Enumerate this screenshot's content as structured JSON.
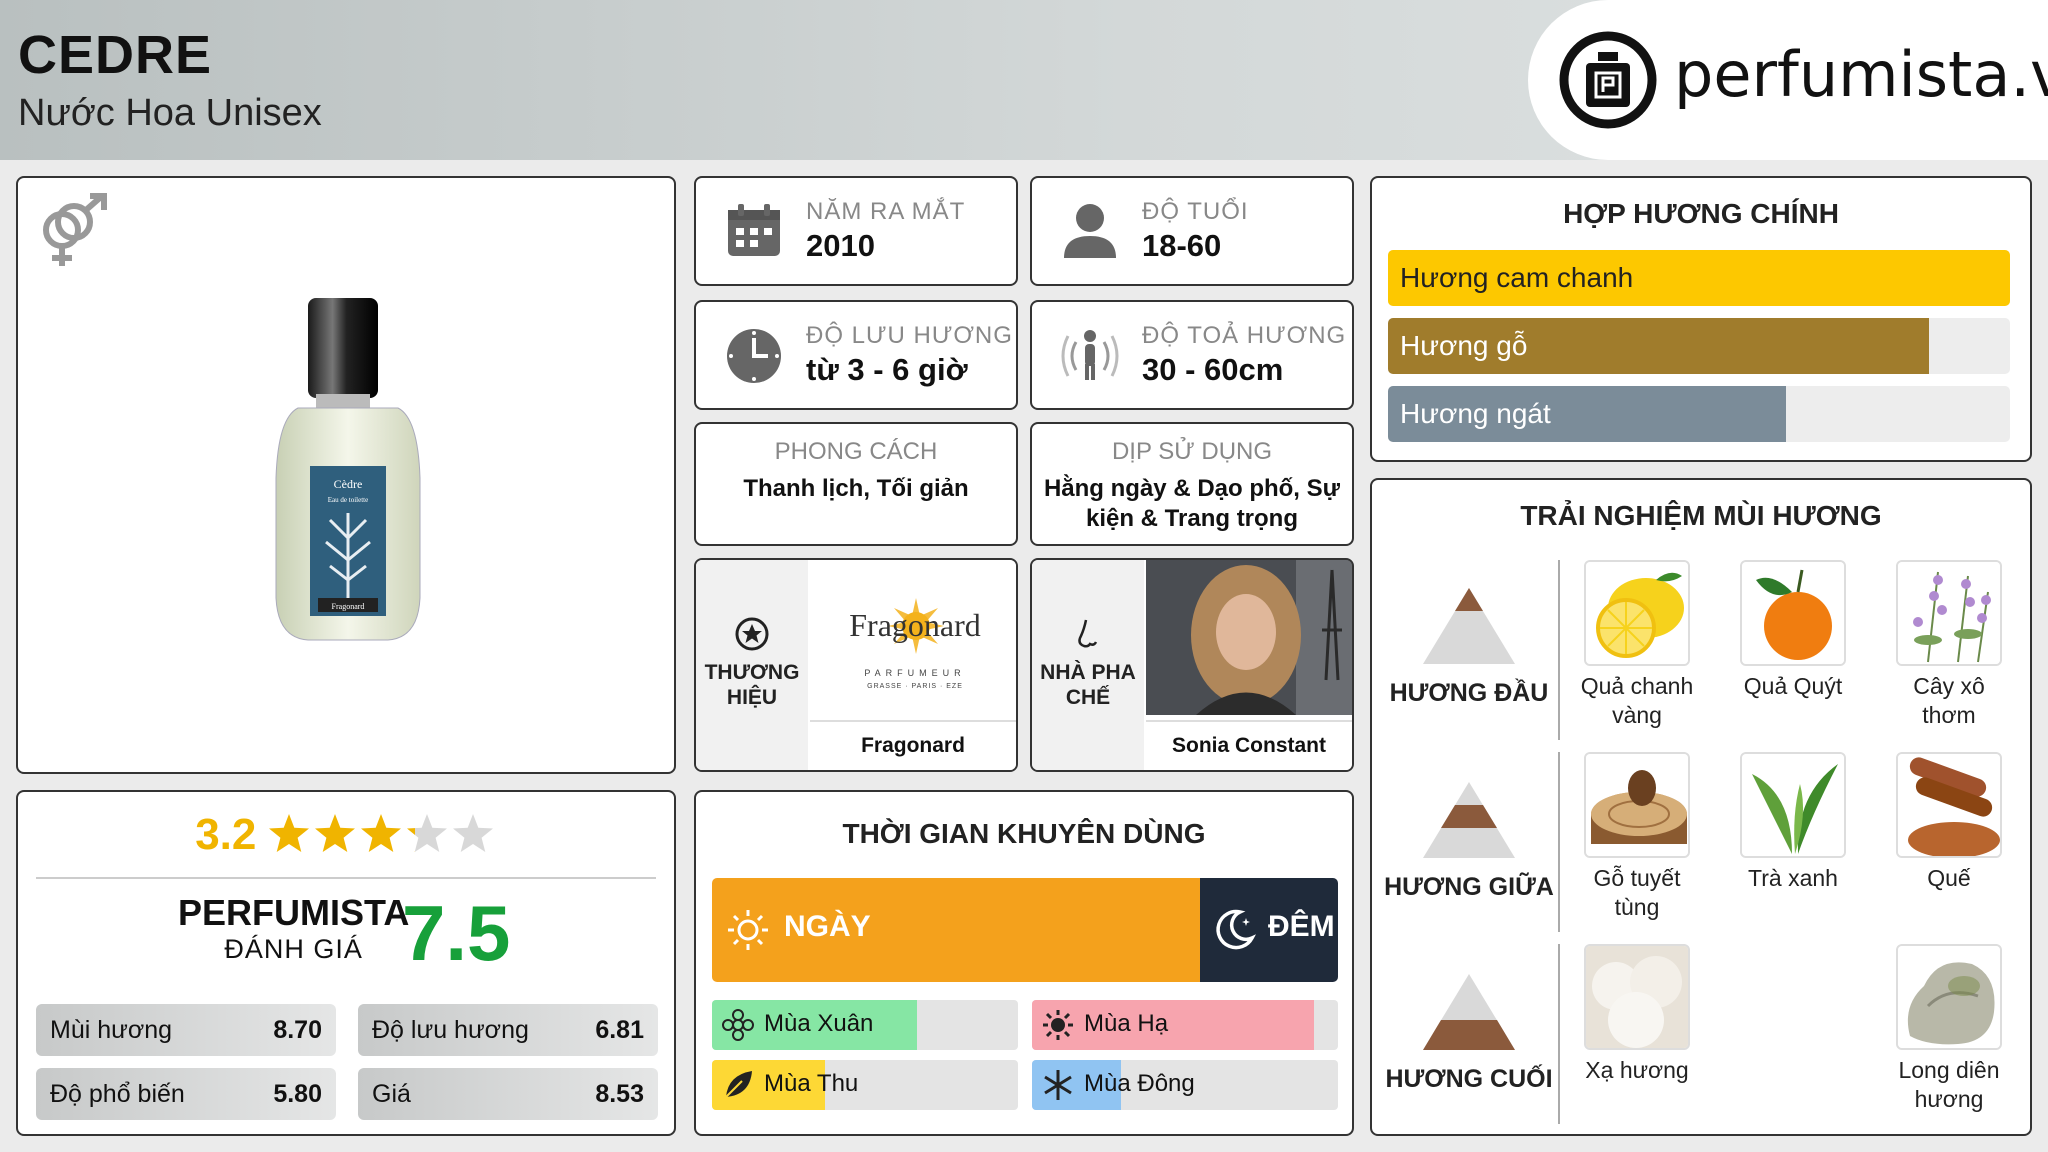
{
  "header": {
    "product_name": "CEDRE",
    "product_type": "Nước Hoa Unisex",
    "logo_text": "perfumista.vn"
  },
  "product_card": {
    "gender_icon": "unisex-gender-icon",
    "bottle_label": "Cèdre",
    "bottle_sublabel": "Eau de toilette",
    "bottle_brand": "Fragonard"
  },
  "rating": {
    "user_score": "3.2",
    "stars_value": 3.2,
    "stars_max": 5,
    "perfumista_label": "PERFUMISTA",
    "perfumista_sub": "ĐÁNH GIÁ",
    "perfumista_score": "7.5",
    "metrics": [
      {
        "label": "Mùi hương",
        "value": "8.70"
      },
      {
        "label": "Độ lưu hương",
        "value": "6.81"
      },
      {
        "label": "Độ phổ biến",
        "value": "5.80"
      },
      {
        "label": "Giá",
        "value": "8.53"
      }
    ]
  },
  "info": {
    "year": {
      "label": "NĂM RA MẮT",
      "value": "2010",
      "icon": "calendar-icon"
    },
    "age": {
      "label": "ĐỘ TUỔI",
      "value": "18-60",
      "icon": "person-icon"
    },
    "longevity": {
      "label": "ĐỘ LƯU HƯƠNG",
      "value": "từ 3 - 6 giờ",
      "icon": "clock-icon"
    },
    "sillage": {
      "label": "ĐỘ TOẢ HƯƠNG",
      "value": "30 - 60cm",
      "icon": "sillage-icon"
    },
    "style": {
      "label": "PHONG CÁCH",
      "value": "Thanh lịch, Tối giản"
    },
    "occasion": {
      "label": "DỊP SỬ DỤNG",
      "value": "Hằng ngày & Dạo phố, Sự kiện & Trang trọng"
    },
    "brand": {
      "label": "THƯƠNG HIỆU",
      "name": "Fragonard",
      "logo_text": "Fragonard",
      "logo_sub": "PARFUMEUR",
      "logo_sub2": "GRASSE · PARIS · EZE"
    },
    "perfumer": {
      "label": "NHÀ PHA CHẾ",
      "name": "Sonia Constant"
    }
  },
  "time": {
    "title": "THỜI GIAN KHUYÊN DÙNG",
    "day_label": "NGÀY",
    "night_label": "ĐÊM",
    "day_fraction": 0.78,
    "seasons": [
      {
        "label": "Mùa Xuân",
        "fraction": 0.67,
        "color": "#86e6a4",
        "icon": "flower-icon"
      },
      {
        "label": "Mùa Hạ",
        "fraction": 0.92,
        "color": "#f7a4ae",
        "icon": "sun-icon"
      },
      {
        "label": "Mùa Thu",
        "fraction": 0.37,
        "color": "#fdd835",
        "icon": "leaf-icon"
      },
      {
        "label": "Mùa Đông",
        "fraction": 0.29,
        "color": "#90c4f2",
        "icon": "snowflake-icon"
      }
    ]
  },
  "accords": {
    "title": "HỢP HƯƠNG CHÍNH",
    "items": [
      {
        "label": "Hương cam chanh",
        "fraction": 1.0,
        "color": "#fdc800",
        "text_color": "#222222"
      },
      {
        "label": "Hương gỗ",
        "fraction": 0.87,
        "color": "#a07c2c",
        "text_color": "#ffffff"
      },
      {
        "label": "Hương ngát",
        "fraction": 0.64,
        "color": "#7b8c99",
        "text_color": "#ffffff"
      }
    ]
  },
  "notes": {
    "title": "TRẢI NGHIỆM MÙI HƯƠNG",
    "tiers": [
      {
        "label": "HƯƠNG ĐẦU",
        "items": [
          "Quả chanh vàng",
          "Quả Quýt",
          "Cây xô thơm"
        ]
      },
      {
        "label": "HƯƠNG GIỮA",
        "items": [
          "Gỗ tuyết tùng",
          "Trà xanh",
          "Quế"
        ]
      },
      {
        "label": "HƯƠNG CUỐI",
        "items": [
          "Xạ hương",
          "Long diên hương"
        ]
      }
    ]
  }
}
